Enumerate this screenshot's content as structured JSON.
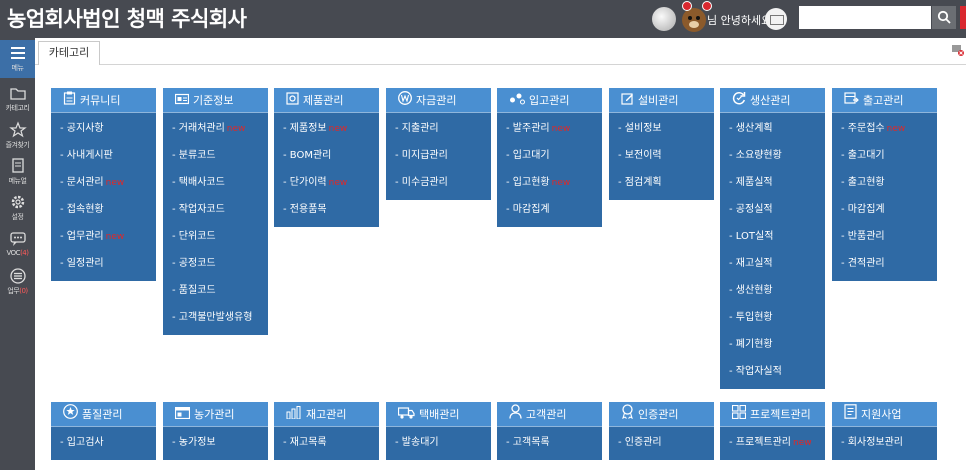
{
  "header": {
    "title": "농업회사법인 청맥 주식회사",
    "greeting": "님 안녕하세요.",
    "search_placeholder": "",
    "icons": [
      "avatar-icon",
      "bear-avatar-icon",
      "mail-icon",
      "search-icon"
    ]
  },
  "sidebar": {
    "items": [
      {
        "label": "메뉴",
        "icon": "hamburger-icon",
        "active": true,
        "count": ""
      },
      {
        "label": "카테고리",
        "icon": "folder-icon",
        "active": false,
        "count": ""
      },
      {
        "label": "즐겨찾기",
        "icon": "star-icon",
        "active": false,
        "count": ""
      },
      {
        "label": "메뉴얼",
        "icon": "manual-icon",
        "active": false,
        "count": ""
      },
      {
        "label": "설정",
        "icon": "gear-icon",
        "active": false,
        "count": ""
      },
      {
        "label": "VOC",
        "icon": "chat-icon",
        "active": false,
        "count": "(4)"
      },
      {
        "label": "업무",
        "icon": "list-icon",
        "active": false,
        "count": "(0)"
      }
    ]
  },
  "tabs": [
    {
      "label": "카테고리"
    }
  ],
  "new_badge": "new",
  "categories": [
    {
      "title": "커뮤니티",
      "icon": "clipboard-icon",
      "items": [
        {
          "label": "공지사항",
          "new": false
        },
        {
          "label": "사내게시판",
          "new": false
        },
        {
          "label": "문서관리",
          "new": true
        },
        {
          "label": "접속현황",
          "new": false
        },
        {
          "label": "업무관리",
          "new": true
        },
        {
          "label": "일정관리",
          "new": false
        }
      ]
    },
    {
      "title": "기준정보",
      "icon": "card-icon",
      "items": [
        {
          "label": "거래처관리",
          "new": true
        },
        {
          "label": "분류코드",
          "new": false
        },
        {
          "label": "택배사코드",
          "new": false
        },
        {
          "label": "작업자코드",
          "new": false
        },
        {
          "label": "단위코드",
          "new": false
        },
        {
          "label": "공정코드",
          "new": false
        },
        {
          "label": "품질코드",
          "new": false
        },
        {
          "label": "고객불만발생유형",
          "new": false
        }
      ]
    },
    {
      "title": "제품관리",
      "icon": "box-icon",
      "items": [
        {
          "label": "제품정보",
          "new": true
        },
        {
          "label": "BOM관리",
          "new": false
        },
        {
          "label": "단가이력",
          "new": true
        },
        {
          "label": "전용품목",
          "new": false
        }
      ]
    },
    {
      "title": "자금관리",
      "icon": "won-icon",
      "items": [
        {
          "label": "지출관리",
          "new": false
        },
        {
          "label": "미지급관리",
          "new": false
        },
        {
          "label": "미수금관리",
          "new": false
        }
      ]
    },
    {
      "title": "입고관리",
      "icon": "flow-icon",
      "items": [
        {
          "label": "발주관리",
          "new": true
        },
        {
          "label": "입고대기",
          "new": false
        },
        {
          "label": "입고현황",
          "new": true
        },
        {
          "label": "마감집계",
          "new": false
        }
      ]
    },
    {
      "title": "설비관리",
      "icon": "edit-icon",
      "items": [
        {
          "label": "설비정보",
          "new": false
        },
        {
          "label": "보전이력",
          "new": false
        },
        {
          "label": "점검계획",
          "new": false
        }
      ]
    },
    {
      "title": "생산관리",
      "icon": "refresh-icon",
      "items": [
        {
          "label": "생산계획",
          "new": false
        },
        {
          "label": "소요량현황",
          "new": false
        },
        {
          "label": "제품실적",
          "new": false
        },
        {
          "label": "공정실적",
          "new": false
        },
        {
          "label": "LOT실적",
          "new": false
        },
        {
          "label": "재고실적",
          "new": false
        },
        {
          "label": "생산현황",
          "new": false
        },
        {
          "label": "투입현황",
          "new": false
        },
        {
          "label": "폐기현황",
          "new": false
        },
        {
          "label": "작업자실적",
          "new": false
        }
      ]
    },
    {
      "title": "출고관리",
      "icon": "shipping-icon",
      "items": [
        {
          "label": "주문접수",
          "new": true
        },
        {
          "label": "출고대기",
          "new": false
        },
        {
          "label": "출고현황",
          "new": false
        },
        {
          "label": "마감집계",
          "new": false
        },
        {
          "label": "반품관리",
          "new": false
        },
        {
          "label": "견적관리",
          "new": false
        }
      ]
    },
    {
      "title": "품질관리",
      "icon": "star-badge-icon",
      "items": [
        {
          "label": "입고검사",
          "new": false
        }
      ]
    },
    {
      "title": "농가관리",
      "icon": "window-icon",
      "items": [
        {
          "label": "농가정보",
          "new": false
        }
      ]
    },
    {
      "title": "재고관리",
      "icon": "bar-chart-icon",
      "items": [
        {
          "label": "재고목록",
          "new": false
        }
      ]
    },
    {
      "title": "택배관리",
      "icon": "truck-icon",
      "items": [
        {
          "label": "발송대기",
          "new": false
        }
      ]
    },
    {
      "title": "고객관리",
      "icon": "person-icon",
      "items": [
        {
          "label": "고객목록",
          "new": false
        }
      ]
    },
    {
      "title": "인증관리",
      "icon": "ribbon-icon",
      "items": [
        {
          "label": "인증관리",
          "new": false
        }
      ]
    },
    {
      "title": "프로젝트관리",
      "icon": "grid-icon",
      "items": [
        {
          "label": "프로젝트관리",
          "new": true
        }
      ]
    },
    {
      "title": "지원사업",
      "icon": "document-icon",
      "items": [
        {
          "label": "회사정보관리",
          "new": false
        }
      ]
    }
  ]
}
